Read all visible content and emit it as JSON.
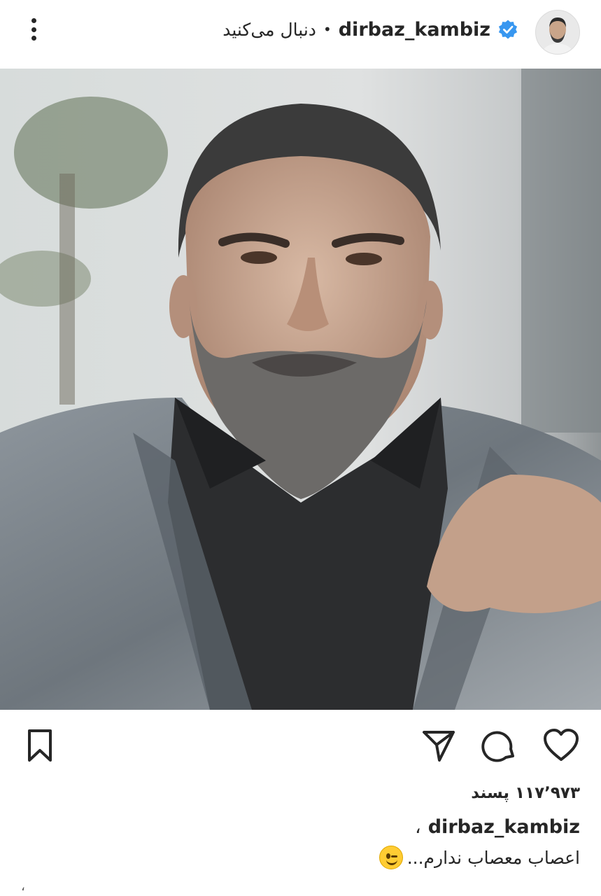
{
  "header": {
    "username": "dirbaz_kambiz",
    "follow_text": "دنبال می‌کنید",
    "separator": "•",
    "verified_icon": "verified-badge-icon",
    "menu_icon": "more-vertical-icon"
  },
  "post": {
    "image_alt": "Portrait of a bearded man in a grey suit",
    "actions": {
      "like_icon": "heart-icon",
      "comment_icon": "comment-icon",
      "share_icon": "send-icon",
      "save_icon": "bookmark-icon"
    },
    "likes_text": "۱۱۷٬۹۷۳ پسند",
    "caption_user": "dirbaz_kambiz",
    "caption_comma": "،",
    "caption_text": "اعصاب معصاب ندارم...",
    "trailing_mark": "،"
  },
  "colors": {
    "verified_blue": "#3897f0",
    "text": "#262626"
  }
}
